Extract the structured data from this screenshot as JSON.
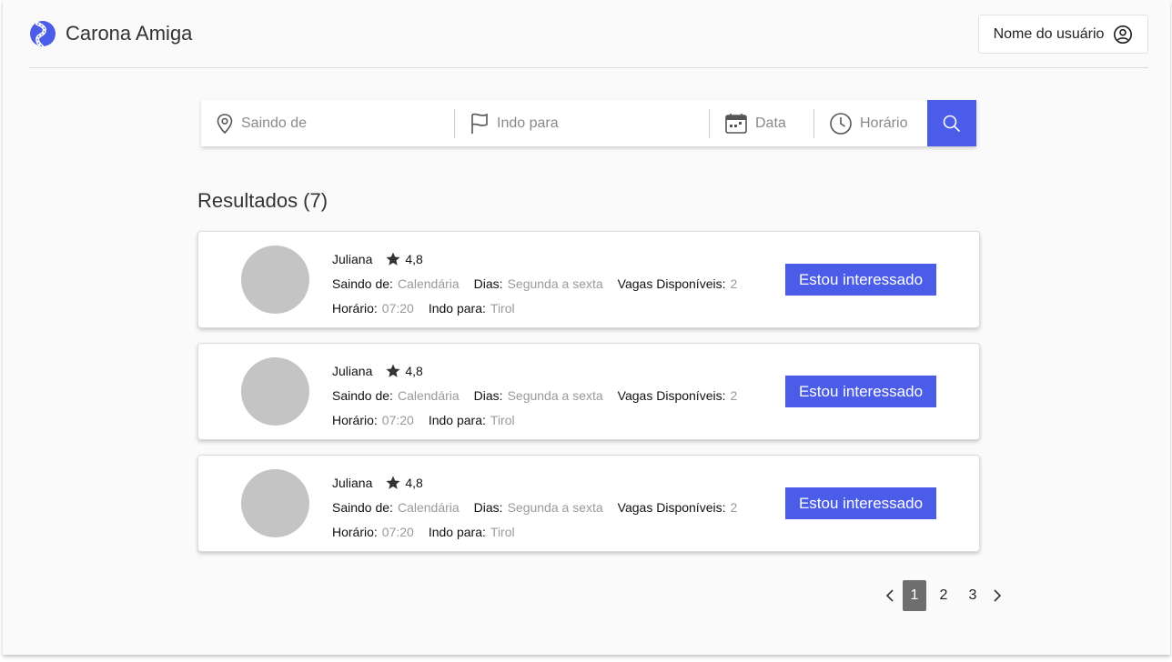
{
  "app": {
    "title": "Carona Amiga",
    "user_label": "Nome do usuário",
    "accent_color": "#4a5ce8"
  },
  "search": {
    "from_placeholder": "Saindo de",
    "to_placeholder": "Indo para",
    "date_placeholder": "Data",
    "time_placeholder": "Horário",
    "icons": [
      "location-pin-icon",
      "flag-icon",
      "calendar-icon",
      "clock-icon",
      "search-icon"
    ]
  },
  "results": {
    "title": "Resultados (7)",
    "labels": {
      "from": "Saindo de:",
      "days": "Dias:",
      "seats": "Vagas Disponíveis:",
      "time": "Horário:",
      "to": "Indo para:",
      "button": "Estou interessado"
    },
    "items": [
      {
        "name": "Juliana",
        "rating": "4,8",
        "from": "Calendária",
        "days": "Segunda a sexta",
        "seats": "2",
        "time": "07:20",
        "to": "Tirol"
      },
      {
        "name": "Juliana",
        "rating": "4,8",
        "from": "Calendária",
        "days": "Segunda a sexta",
        "seats": "2",
        "time": "07:20",
        "to": "Tirol"
      },
      {
        "name": "Juliana",
        "rating": "4,8",
        "from": "Calendária",
        "days": "Segunda a sexta",
        "seats": "2",
        "time": "07:20",
        "to": "Tirol"
      }
    ]
  },
  "pagination": {
    "pages": [
      "1",
      "2",
      "3"
    ],
    "current": "1"
  }
}
